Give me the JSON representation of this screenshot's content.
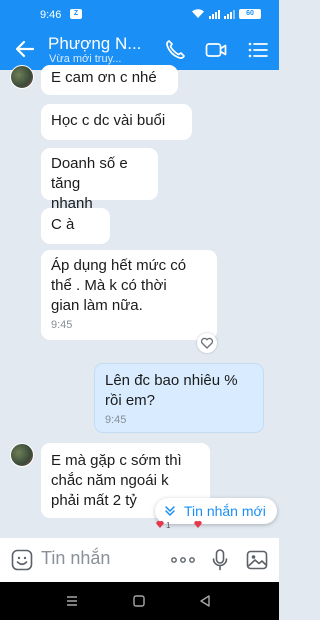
{
  "status_bar": {
    "time": "9:46",
    "notification_badge": "Z",
    "battery_level": "60"
  },
  "header": {
    "contact_name": "Phượng N...",
    "subtitle": "Vừa mới truy...",
    "icons": [
      "back-arrow-icon",
      "phone-icon",
      "video-call-icon",
      "menu-list-icon"
    ]
  },
  "messages": [
    {
      "direction": "in",
      "text": "E cam ơn c nhé",
      "time": ""
    },
    {
      "direction": "in",
      "text": "Học c dc vài buổi",
      "time": ""
    },
    {
      "direction": "in",
      "text_lines": [
        "Doanh số e tăng",
        "nhanh"
      ],
      "time": ""
    },
    {
      "direction": "in",
      "text": "C à",
      "time": ""
    },
    {
      "direction": "in",
      "text_lines": [
        "Áp dụng hết mức có",
        "thể . Mà k có thời",
        "gian làm nữa."
      ],
      "time": "9:45"
    },
    {
      "direction": "out",
      "text_lines": [
        "Lên đc bao nhiêu %",
        "rồi em?"
      ],
      "time": "9:45"
    },
    {
      "direction": "in",
      "text_lines": [
        "E mà gặp c sớm thì",
        "chắc năm ngoái k",
        "phải mất 2 tỷ"
      ],
      "time": ""
    }
  ],
  "new_message_button": {
    "label": "Tin nhắn mới"
  },
  "composer": {
    "placeholder": "Tin nhắn"
  },
  "colors": {
    "brand": "#1a8ff6",
    "chat_bg": "#e2e9f1",
    "incoming_bubble": "#ffffff",
    "outgoing_bubble": "#d9ecff",
    "reaction_heart": "#e5384d"
  }
}
